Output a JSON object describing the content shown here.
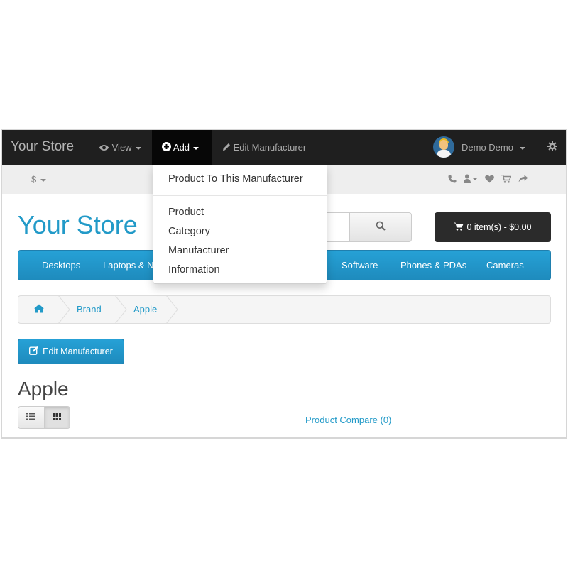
{
  "admin_bar": {
    "brand": "Your Store",
    "view_label": "View",
    "add_label": "Add",
    "edit_label": "Edit Manufacturer",
    "user_name": "Demo Demo"
  },
  "add_menu": {
    "items": [
      "Product To This Manufacturer",
      "Product",
      "Category",
      "Manufacturer",
      "Information"
    ]
  },
  "top_bar": {
    "currency": "$"
  },
  "header": {
    "logo": "Your Store",
    "cart_label": "0 item(s) - $0.00"
  },
  "categories": [
    "Desktops",
    "Laptops & N",
    "Software",
    "Phones & PDAs",
    "Cameras"
  ],
  "breadcrumb": [
    "Brand",
    "Apple"
  ],
  "content": {
    "edit_button": "Edit Manufacturer",
    "title": "Apple",
    "compare_link": "Product Compare (0)"
  },
  "colors": {
    "accent": "#229ac8",
    "admin_bar": "#1f1f1f",
    "cart_button": "#2b2b2b"
  },
  "icons": [
    "eye-icon",
    "plus-circle-icon",
    "pencil-icon",
    "user-avatar",
    "gear-icon",
    "phone-icon",
    "account-icon",
    "heart-icon",
    "cart-icon",
    "share-icon",
    "search-icon",
    "home-icon",
    "edit-icon",
    "list-view-icon",
    "grid-view-icon"
  ]
}
